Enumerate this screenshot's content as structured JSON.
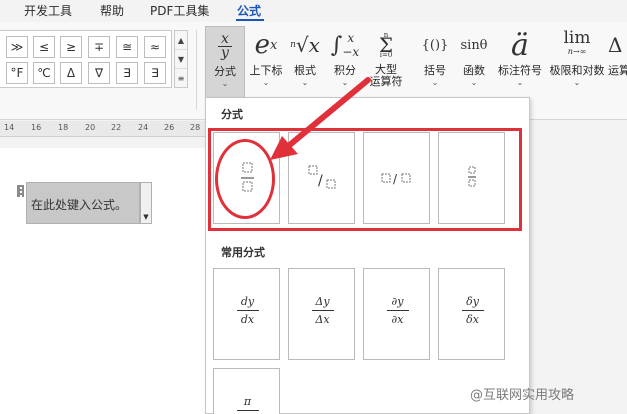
{
  "tabs": [
    "开发工具",
    "帮助",
    "PDF工具集",
    "公式"
  ],
  "symbol_gallery": {
    "row1": [
      "≫",
      "≤",
      "≥",
      "∓",
      "≅",
      "≈"
    ],
    "row2": [
      "°F",
      "℃",
      "Δ",
      "∇",
      "∃",
      "∃"
    ]
  },
  "ribbon_buttons": [
    {
      "label": "分式",
      "glyph": "x/y"
    },
    {
      "label": "上下标",
      "glyph": "eˣ"
    },
    {
      "label": "根式",
      "glyph": "ⁿ√x"
    },
    {
      "label": "积分",
      "glyph": "∫"
    },
    {
      "label": "大型",
      "label2": "运算符",
      "glyph": "Σ"
    },
    {
      "label": "括号",
      "glyph": "{()}"
    },
    {
      "label": "函数",
      "glyph": "sinθ"
    },
    {
      "label": "标注符号",
      "glyph": "ä"
    },
    {
      "label": "极限和对数",
      "glyph": "lim"
    },
    {
      "label": "运算",
      "glyph": "Δ"
    }
  ],
  "ruler_ticks": [
    "14",
    "16",
    "18",
    "20",
    "22",
    "24",
    "26",
    "28"
  ],
  "equation_placeholder": "在此处键入公式。",
  "panel": {
    "section1_title": "分式",
    "section2_title": "常用分式",
    "common_fractions": [
      {
        "num": "dy",
        "den": "dx"
      },
      {
        "num": "Δy",
        "den": "Δx"
      },
      {
        "num": "∂y",
        "den": "∂x"
      },
      {
        "num": "δy",
        "den": "δx"
      },
      {
        "num": "π",
        "den": ""
      }
    ]
  },
  "watermark": "@互联网实用攻略",
  "colors": {
    "accent": "#1a56b8",
    "highlight": "#e0303a"
  }
}
